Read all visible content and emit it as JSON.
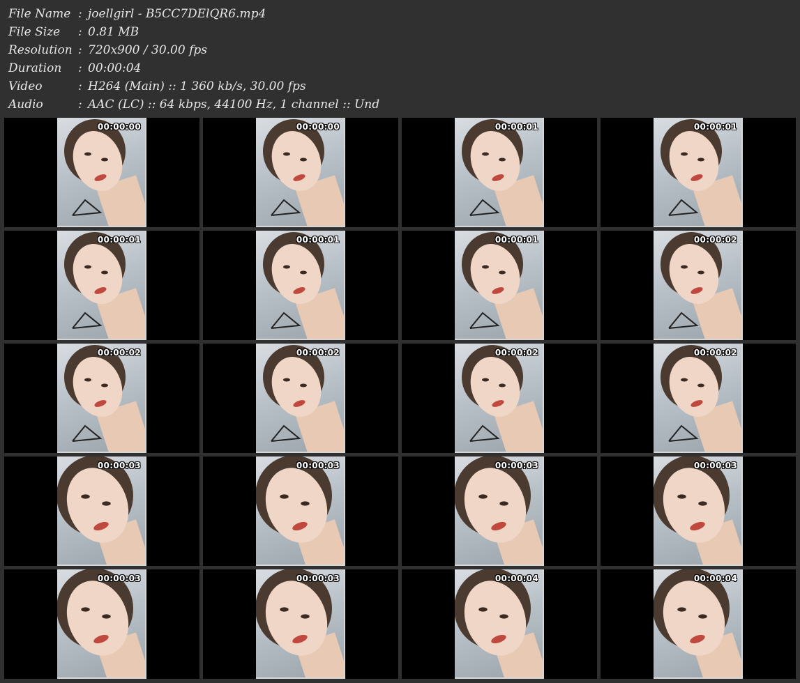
{
  "info": {
    "rows": [
      {
        "label": "File Name",
        "sep": ":",
        "value": "joellgirl - B5CC7DElQR6.mp4"
      },
      {
        "label": "File Size",
        "sep": ":",
        "value": "0.81 MB"
      },
      {
        "label": "Resolution",
        "sep": ":",
        "value": "720x900 / 30.00 fps"
      },
      {
        "label": "Duration",
        "sep": ":",
        "value": "00:00:04"
      },
      {
        "label": "Video",
        "sep": ":",
        "value": "H264 (Main) :: 1 360 kb/s, 30.00 fps"
      },
      {
        "label": "Audio",
        "sep": ":",
        "value": "AAC (LC) :: 64 kbps, 44100 Hz, 1 channel :: Und"
      }
    ]
  },
  "thumbnails": [
    {
      "timestamp": "00:00:00"
    },
    {
      "timestamp": "00:00:00"
    },
    {
      "timestamp": "00:00:01"
    },
    {
      "timestamp": "00:00:01"
    },
    {
      "timestamp": "00:00:01"
    },
    {
      "timestamp": "00:00:01"
    },
    {
      "timestamp": "00:00:01"
    },
    {
      "timestamp": "00:00:02"
    },
    {
      "timestamp": "00:00:02"
    },
    {
      "timestamp": "00:00:02"
    },
    {
      "timestamp": "00:00:02"
    },
    {
      "timestamp": "00:00:02"
    },
    {
      "timestamp": "00:00:03"
    },
    {
      "timestamp": "00:00:03"
    },
    {
      "timestamp": "00:00:03"
    },
    {
      "timestamp": "00:00:03"
    },
    {
      "timestamp": "00:00:03"
    },
    {
      "timestamp": "00:00:03"
    },
    {
      "timestamp": "00:00:04"
    },
    {
      "timestamp": "00:00:04"
    }
  ],
  "colors": {
    "background": "#303030",
    "cell": "#000000",
    "text": "#e6e6e6"
  }
}
